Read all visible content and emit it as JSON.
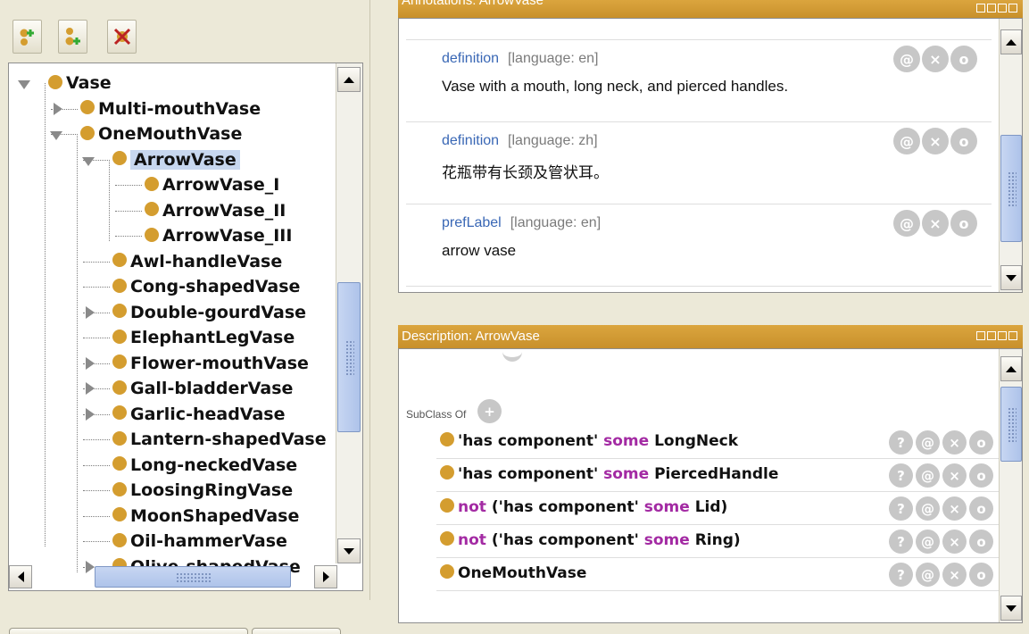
{
  "colors": {
    "accent_header": "#d09a34",
    "class_dot": "#d49d2f",
    "selection": "#c7d7ef",
    "link_blue": "#3967b5",
    "keyword": "#a32aa3"
  },
  "toolbar": {
    "add_subclass_icon": "add-subclass-icon",
    "add_sibling_icon": "add-sibling-icon",
    "delete_icon": "delete-class-icon"
  },
  "tree": {
    "items": [
      {
        "label": "Vase",
        "expander": "down"
      },
      {
        "label": "Multi-mouthVase",
        "expander": "right"
      },
      {
        "label": "OneMouthVase",
        "expander": "down"
      },
      {
        "label": "ArrowVase",
        "expander": "down",
        "selected": true
      },
      {
        "label": "ArrowVase_I",
        "expander": "none"
      },
      {
        "label": "ArrowVase_II",
        "expander": "none"
      },
      {
        "label": "ArrowVase_III",
        "expander": "none"
      },
      {
        "label": "Awl-handleVase",
        "expander": "none"
      },
      {
        "label": "Cong-shapedVase",
        "expander": "none"
      },
      {
        "label": "Double-gourdVase",
        "expander": "right"
      },
      {
        "label": "ElephantLegVase",
        "expander": "none"
      },
      {
        "label": "Flower-mouthVase",
        "expander": "right"
      },
      {
        "label": "Gall-bladderVase",
        "expander": "right"
      },
      {
        "label": "Garlic-headVase",
        "expander": "right"
      },
      {
        "label": "Lantern-shapedVase",
        "expander": "none"
      },
      {
        "label": "Long-neckedVase",
        "expander": "none"
      },
      {
        "label": "LoosingRingVase",
        "expander": "none"
      },
      {
        "label": "MoonShapedVase",
        "expander": "none"
      },
      {
        "label": "Oil-hammerVase",
        "expander": "none"
      },
      {
        "label": "Olive-shapedVase",
        "expander": "right"
      }
    ]
  },
  "annotations": {
    "title": "Annotations: ArrowVase",
    "rows": [
      {
        "property": "definition",
        "language": "[language: en]",
        "value": "Vase with a mouth, long neck,  and pierced handles."
      },
      {
        "property": "definition",
        "language": "[language: zh]",
        "value": "花瓶带有长颈及管状耳。"
      },
      {
        "property": "prefLabel",
        "language": "[language: en]",
        "value": "arrow vase"
      }
    ],
    "button_glyphs": {
      "annotate": "@",
      "delete": "×",
      "edit": "o"
    }
  },
  "description": {
    "title": "Description: ArrowVase",
    "section_label": "SubClass Of",
    "add_glyph": "+",
    "rows": [
      {
        "pre": "'has component'",
        "kw": "some",
        "post": "LongNeck"
      },
      {
        "pre": "'has component'",
        "kw": "some",
        "post": "PiercedHandle"
      },
      {
        "lead_kw": "not",
        "pre": "('has component'",
        "kw": "some",
        "post": "Lid)"
      },
      {
        "lead_kw": "not",
        "pre": "('has component'",
        "kw": "some",
        "post": "Ring)"
      },
      {
        "pre": "OneMouthVase"
      }
    ],
    "button_glyphs": {
      "explain": "?",
      "annotate": "@",
      "delete": "×",
      "edit": "o"
    }
  }
}
